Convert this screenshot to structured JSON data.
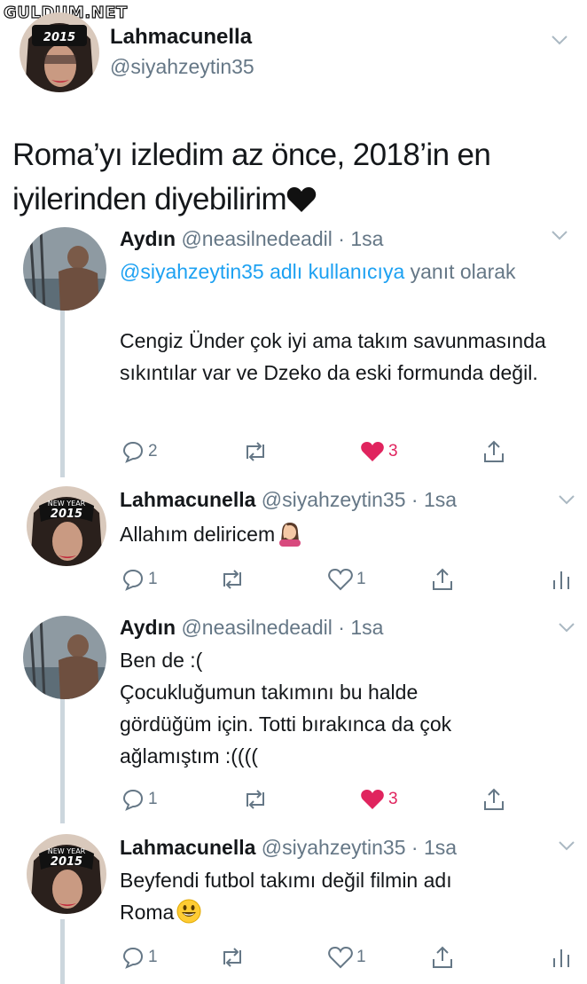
{
  "watermark": "GULDUM.NET",
  "colors": {
    "link": "#1da1f2",
    "muted": "#657786",
    "like": "#e0245e",
    "thread": "#ccd6dd"
  },
  "main_tweet": {
    "name": "Lahmacunella",
    "handle": "@siyahzeytin35",
    "avatar_caption": "2015",
    "text": "Roma’yı izledim az önce, 2018’in en iyilerinden diyebilirim",
    "emoji": "black-heart"
  },
  "replies": [
    {
      "name": "Aydın",
      "handle": "@neasilnedeadil",
      "time": "1sa",
      "reply_to": "@siyahzeytin35 adlı kullanıcıya",
      "reply_suffix": "yanıt olarak",
      "text": "Cengiz Ünder çok iyi ama takım savunmasında sıkıntılar var ve Dzeko da eski formunda değil.",
      "replies": "2",
      "likes": "3",
      "liked": true
    },
    {
      "name": "Lahmacunella",
      "handle": "@siyahzeytin35",
      "time": "1sa",
      "avatar_caption": "2015",
      "avatar_banner": "NEW YEAR",
      "text": "Allahım deliricem",
      "emoji": "woman-facepalming",
      "replies": "1",
      "likes": "1",
      "liked": false
    },
    {
      "name": "Aydın",
      "handle": "@neasilnedeadil",
      "time": "1sa",
      "text_lines": [
        "Ben de :(",
        "Çocukluğumun takımını bu halde",
        "gördüğüm için. Totti bırakınca da çok",
        "ağlamıştım :(((("
      ],
      "replies": "1",
      "likes": "3",
      "liked": true
    },
    {
      "name": "Lahmacunella",
      "handle": "@siyahzeytin35",
      "time": "1sa",
      "avatar_caption": "2015",
      "avatar_banner": "NEW YEAR",
      "text_lines": [
        "Beyfendi futbol takımı değil filmin adı",
        "Roma"
      ],
      "emoji": "grinning-face",
      "replies": "1",
      "likes": "1",
      "liked": false
    }
  ],
  "separator": "·"
}
